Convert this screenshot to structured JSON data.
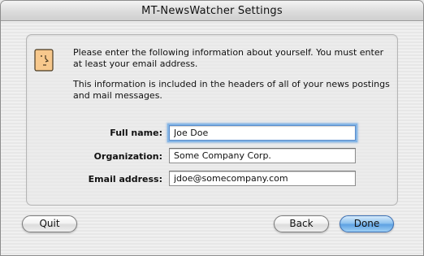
{
  "window": {
    "title": "MT-NewsWatcher Settings"
  },
  "intro": {
    "paragraph1": "Please enter the following information about yourself. You must enter at least your email address.",
    "paragraph2": "This information is included in the headers of all of your news postings and mail messages."
  },
  "icon": "face-profile-icon",
  "form": {
    "full_name": {
      "label": "Full name:",
      "value": "Joe Doe"
    },
    "organization": {
      "label": "Organization:",
      "value": "Some Company Corp."
    },
    "email": {
      "label": "Email address:",
      "value": "jdoe@somecompany.com"
    }
  },
  "buttons": {
    "quit": "Quit",
    "back": "Back",
    "done": "Done"
  },
  "colors": {
    "default_button": "#5ea1e2",
    "focus_ring": "#85b6e6"
  }
}
